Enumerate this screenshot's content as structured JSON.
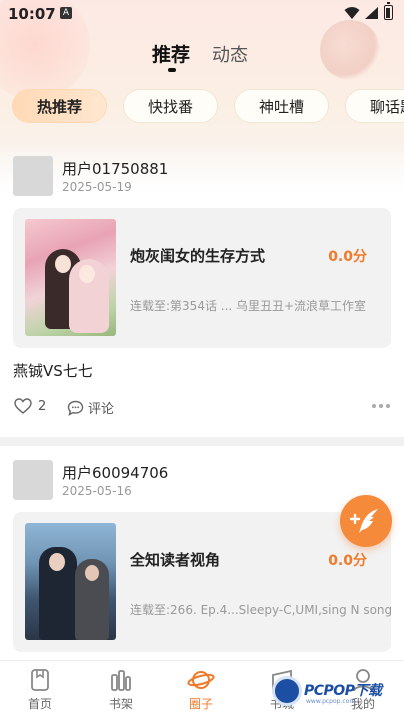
{
  "status_bar": {
    "time": "10:07",
    "notification_badge": "A"
  },
  "top_tabs": [
    {
      "label": "推荐",
      "active": true
    },
    {
      "label": "动态",
      "active": false
    }
  ],
  "chips": [
    {
      "label": "热推荐",
      "active": true
    },
    {
      "label": "快找番",
      "active": false
    },
    {
      "label": "神吐槽",
      "active": false
    },
    {
      "label": "聊话题",
      "active": false
    }
  ],
  "posts": [
    {
      "username": "用户01750881",
      "date": "2025-05-19",
      "manga": {
        "title": "炮灰闺女的生存方式",
        "score": "0.0分",
        "meta": "连载至:第354话 ...",
        "author": "乌里丑丑+流浪草工作室"
      },
      "text": "燕铖VS七七",
      "likes": "2",
      "comment_label": "评论"
    },
    {
      "username": "用户60094706",
      "date": "2025-05-16",
      "manga": {
        "title": "全知读者视角",
        "score": "0.0分",
        "meta": "连载至:266. Ep.4...Sleepy-C,UMI,sing N song",
        "author": ""
      }
    }
  ],
  "bottom_nav": [
    {
      "label": "首页",
      "icon": "home-icon",
      "active": false
    },
    {
      "label": "书架",
      "icon": "bookshelf-icon",
      "active": false
    },
    {
      "label": "圈子",
      "icon": "planet-icon",
      "active": true
    },
    {
      "label": "书城",
      "icon": "store-icon",
      "active": false
    },
    {
      "label": "我的",
      "icon": "profile-icon",
      "active": false
    }
  ],
  "watermark": {
    "brand": "PCPOP下载",
    "sub": "www.pcpop.com"
  },
  "colors": {
    "accent": "#f07a2a",
    "fab": "#f58a3a",
    "chip_active": "#ffd9b6"
  }
}
